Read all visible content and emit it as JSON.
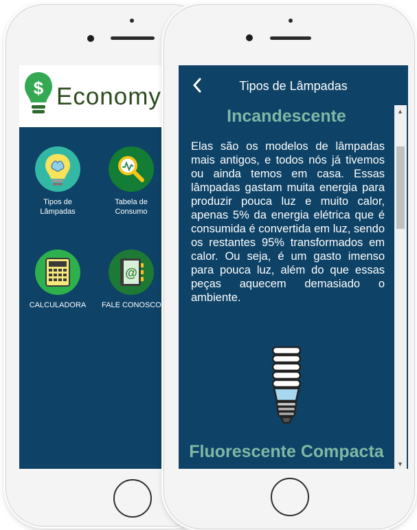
{
  "back_app": {
    "logo_text": "Economy",
    "logo_icon": "lightbulb-dollar-icon",
    "menu": [
      {
        "label": "Tipos de Lâmpadas",
        "icon": "brain-bulb-icon",
        "color": "#33b8a4"
      },
      {
        "label": "Tabela de Consumo",
        "icon": "magnifier-chart-icon",
        "color": "#137c35"
      },
      {
        "label": "CALCULADORA",
        "icon": "calculator-icon",
        "color": "#2eb04d"
      },
      {
        "label": "FALE CONOSCO",
        "icon": "contact-book-icon",
        "color": "#1d7a34"
      }
    ]
  },
  "front_app": {
    "title": "Tipos de Lâmpadas",
    "sections": [
      {
        "heading": "Incandescente",
        "body": "Elas são os modelos de lâmpadas mais antigos, e todos nós já tivemos ou ainda temos em casa. Essas lâmpadas gastam muita energia para produzir pouca luz e muito calor, apenas 5% da energia elétrica que é consumida é convertida em luz, sendo os restantes 95% transformados em calor. Ou seja, é um gasto imenso para pouca luz, além do que essas peças aquecem demasiado o ambiente.",
        "image_icon": "cfl-bulb-icon"
      },
      {
        "heading": "Fluorescente Compacta"
      }
    ]
  },
  "colors": {
    "screen_bg": "#0e4266",
    "section_heading": "#7fb8a6",
    "text": "#ffffff"
  }
}
